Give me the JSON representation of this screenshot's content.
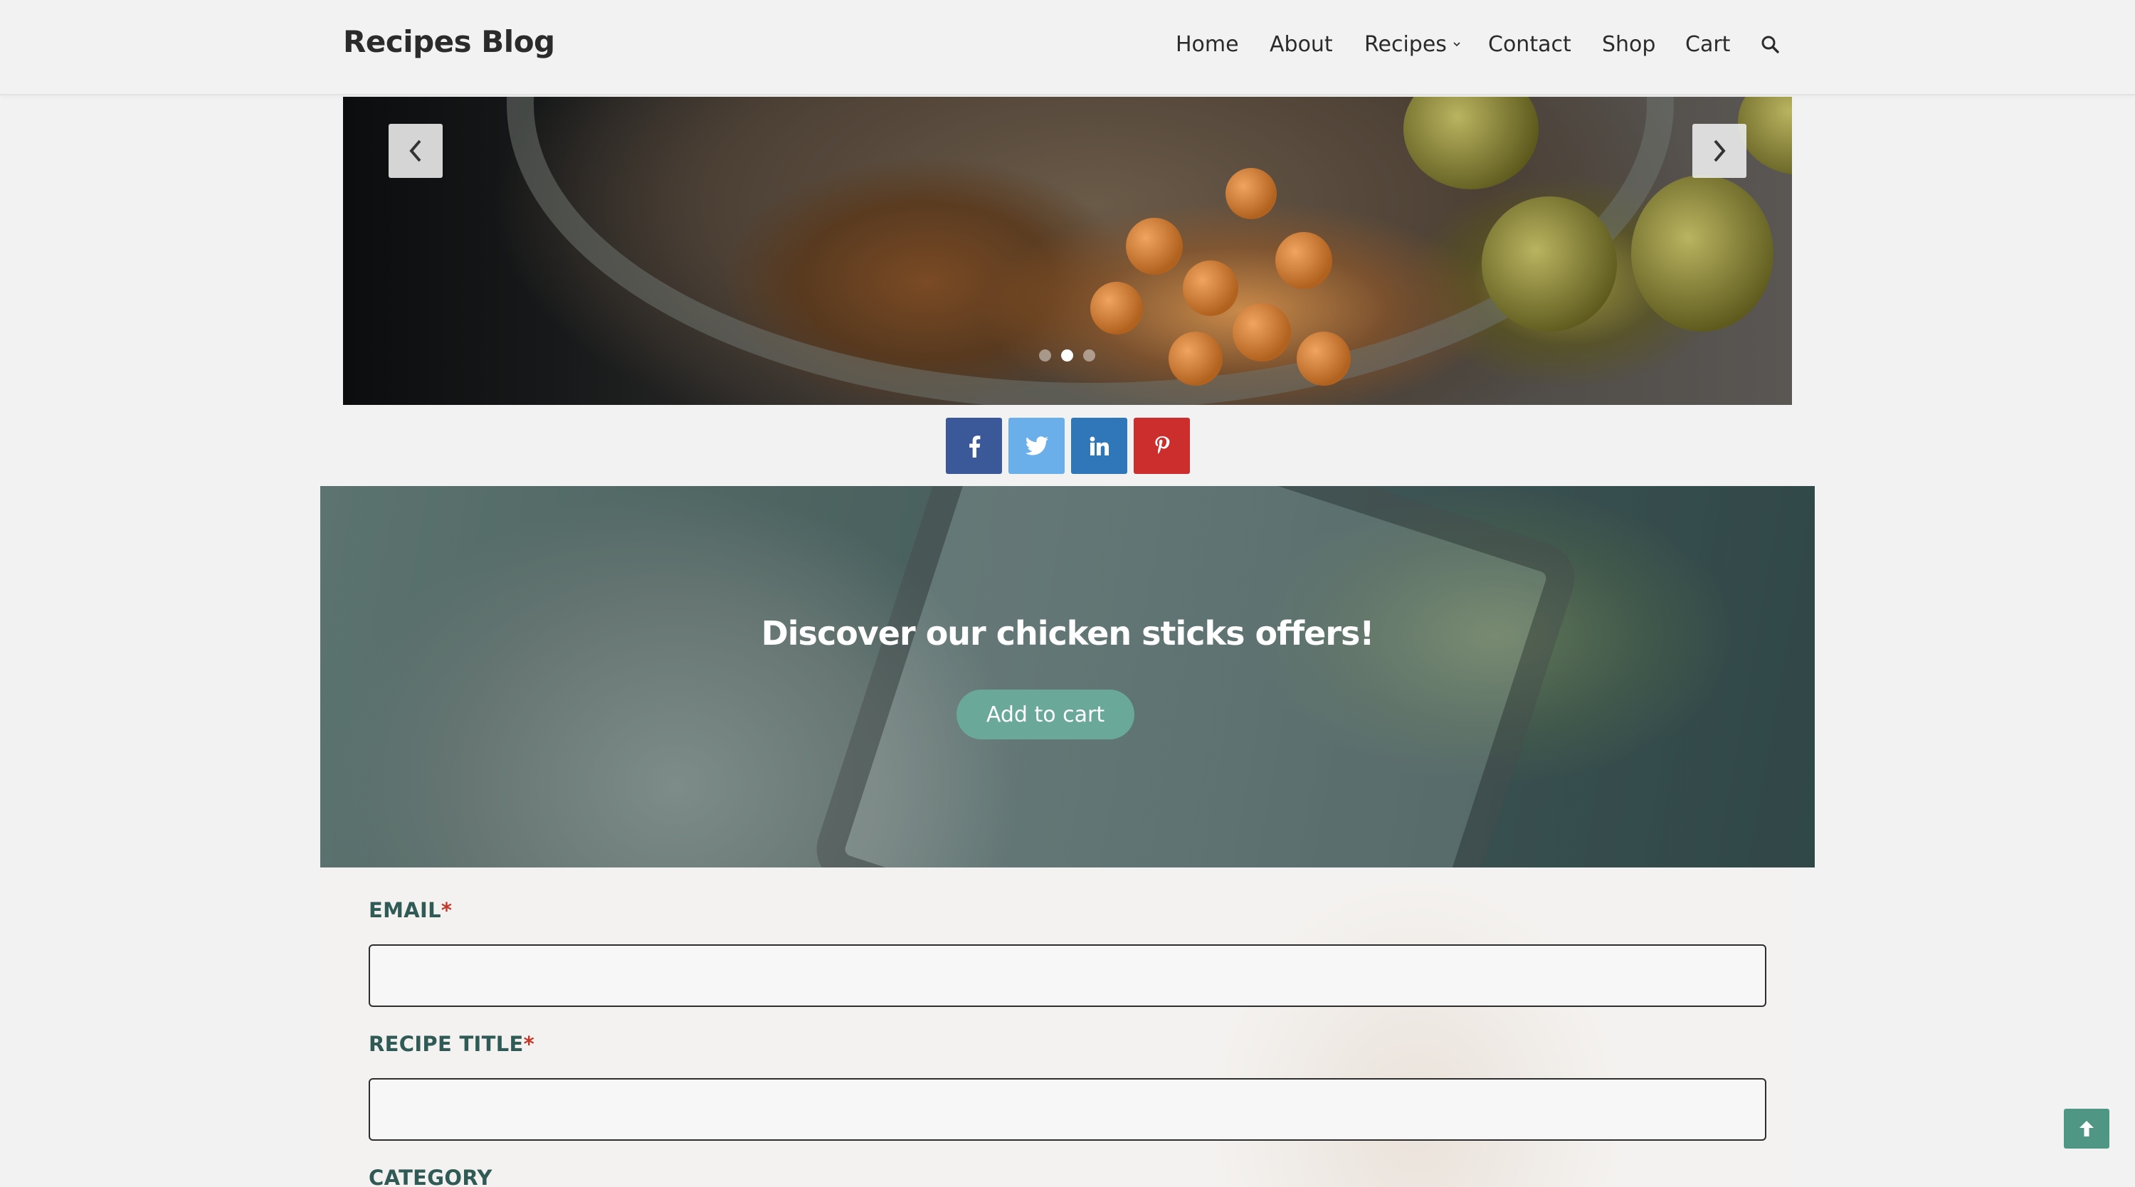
{
  "header": {
    "logo": "Recipes Blog",
    "nav": [
      {
        "label": "Home"
      },
      {
        "label": "About"
      },
      {
        "label": "Recipes",
        "has_dropdown": true
      },
      {
        "label": "Contact"
      },
      {
        "label": "Shop"
      },
      {
        "label": "Cart"
      }
    ],
    "search_icon": "search-icon"
  },
  "slider": {
    "prev_icon": "chevron-left-icon",
    "next_icon": "chevron-right-icon",
    "slide_count": 3,
    "active_slide": 2
  },
  "share": [
    {
      "network": "facebook",
      "icon": "facebook-icon",
      "color": "#3b5998"
    },
    {
      "network": "twitter",
      "icon": "twitter-icon",
      "color": "#6aafe9"
    },
    {
      "network": "linkedin",
      "icon": "linkedin-icon",
      "color": "#2f77b9"
    },
    {
      "network": "pinterest",
      "icon": "pinterest-icon",
      "color": "#cc2d2d"
    }
  ],
  "promo": {
    "title": "Discover our chicken sticks offers!",
    "button_label": "Add to cart",
    "button_color": "#6aa89a"
  },
  "form": {
    "email_label": "EMAIL",
    "recipe_title_label": "RECIPE TITLE",
    "category_label": "CATEGORY",
    "required_marker": "*",
    "label_color": "#2f5a55"
  },
  "scroll_top": {
    "icon": "arrow-up-icon",
    "color": "#4f9784"
  }
}
